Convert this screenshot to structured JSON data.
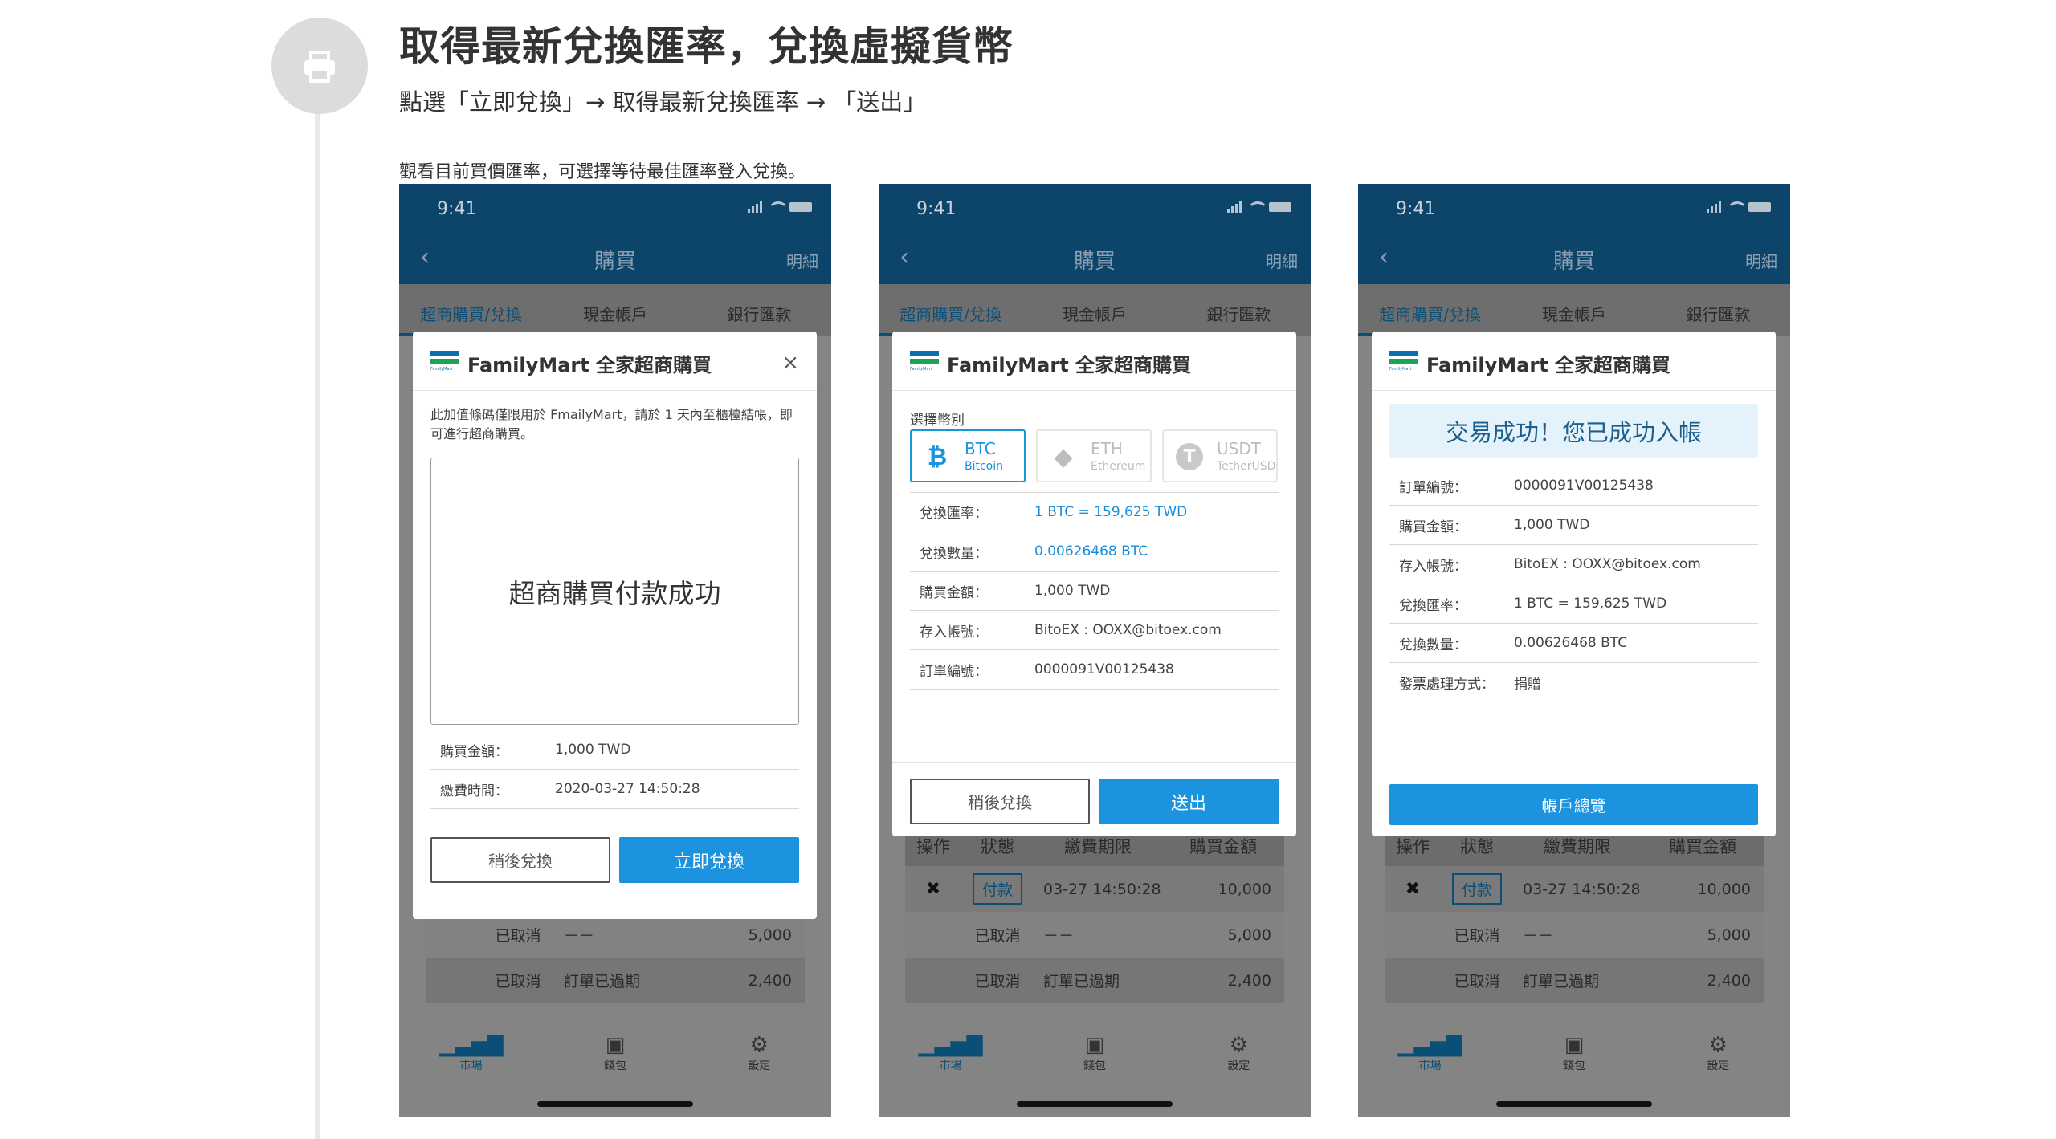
{
  "step": {
    "icon": "printer-icon",
    "title": "取得最新兌換匯率，兌換虛擬貨幣",
    "subtitle": "點選「立即兌換」→ 取得最新兌換匯率 → 「送出」",
    "note": "觀看目前買價匯率，可選擇等待最佳匯率登入兌換。"
  },
  "phone": {
    "time": "9:41",
    "nav_title": "購買",
    "nav_detail": "明細",
    "tabs": [
      "超商購買/兌換",
      "現金帳戶",
      "銀行匯款"
    ],
    "table_headers": [
      "操作",
      "狀態",
      "繳費期限",
      "購買金額"
    ],
    "rows": [
      {
        "op": "✖",
        "status": "付款",
        "deadline": "03-27 14:50:28",
        "amount": "10,000"
      },
      {
        "op": "",
        "status": "已取消",
        "deadline": "－－",
        "amount": "5,000"
      },
      {
        "op": "",
        "status": "已取消",
        "deadline": "訂單已過期",
        "amount": "2,400"
      }
    ],
    "tabbar": [
      {
        "label": "市場",
        "icon": "chart-bars-icon"
      },
      {
        "label": "錢包",
        "icon": "wallet-icon"
      },
      {
        "label": "設定",
        "icon": "gear-icon"
      }
    ]
  },
  "modal_brand": {
    "title": "FamilyMart 全家超商購買",
    "logo_text": "FamilyMart"
  },
  "screen1": {
    "close": "×",
    "desc": "此加值條碼僅限用於 FmailyMart，請於 1 天內至櫃檯結帳，即可進行超商購買。",
    "box_text": "超商購買付款成功",
    "rows": [
      {
        "label": "購買金額：",
        "value": "1,000 TWD"
      },
      {
        "label": "繳費時間：",
        "value": "2020-03-27 14:50:28"
      }
    ],
    "btn_later": "稍後兌換",
    "btn_now": "立即兌換"
  },
  "screen2": {
    "coin_label": "選擇幣別",
    "coins": [
      {
        "symbol": "BTC",
        "name": "Bitcoin"
      },
      {
        "symbol": "ETH",
        "name": "Ethereum"
      },
      {
        "symbol": "USDT",
        "name": "TetherUSD"
      }
    ],
    "rows": [
      {
        "label": "兌換匯率：",
        "value": "1 BTC = 159,625 TWD"
      },
      {
        "label": "兌換數量：",
        "value": "0.00626468 BTC"
      },
      {
        "label": "購買金額：",
        "value": "1,000 TWD"
      },
      {
        "label": "存入帳號：",
        "value": "BitoEX : OOXX@bitoex.com"
      },
      {
        "label": "訂單編號：",
        "value": "0000091V00125438"
      }
    ],
    "btn_later": "稍後兌換",
    "btn_submit": "送出"
  },
  "screen3": {
    "banner": "交易成功！您已成功入帳",
    "rows": [
      {
        "label": "訂單編號：",
        "value": "0000091V00125438"
      },
      {
        "label": "購買金額：",
        "value": "1,000 TWD"
      },
      {
        "label": "存入帳號：",
        "value": "BitoEX : OOXX@bitoex.com"
      },
      {
        "label": "兌換匯率：",
        "value": "1 BTC = 159,625 TWD"
      },
      {
        "label": "兌換數量：",
        "value": "0.00626468 BTC"
      },
      {
        "label": "發票處理方式：",
        "value": "捐贈"
      }
    ],
    "btn_overview": "帳戶總覽"
  },
  "colors": {
    "nav": "#0c446a",
    "primary": "#1b93de",
    "overlay": "#848484",
    "success_bg": "#e3f2fb"
  }
}
